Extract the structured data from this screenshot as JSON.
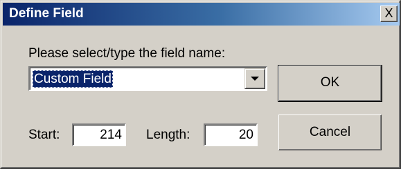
{
  "window": {
    "title": "Define Field",
    "close_label": "X"
  },
  "form": {
    "prompt": "Please select/type the field name:",
    "field_name_value": "Custom Field",
    "start_label": "Start:",
    "start_value": "214",
    "length_label": "Length:",
    "length_value": "20"
  },
  "buttons": {
    "ok_label": "OK",
    "cancel_label": "Cancel"
  },
  "icons": {
    "dropdown": "chevron-down-icon",
    "close": "close-icon"
  },
  "colors": {
    "titlebar_start": "#0a246a",
    "titlebar_end": "#a6caf0",
    "dialog_face": "#d4d0c8",
    "selection": "#0a246a"
  }
}
